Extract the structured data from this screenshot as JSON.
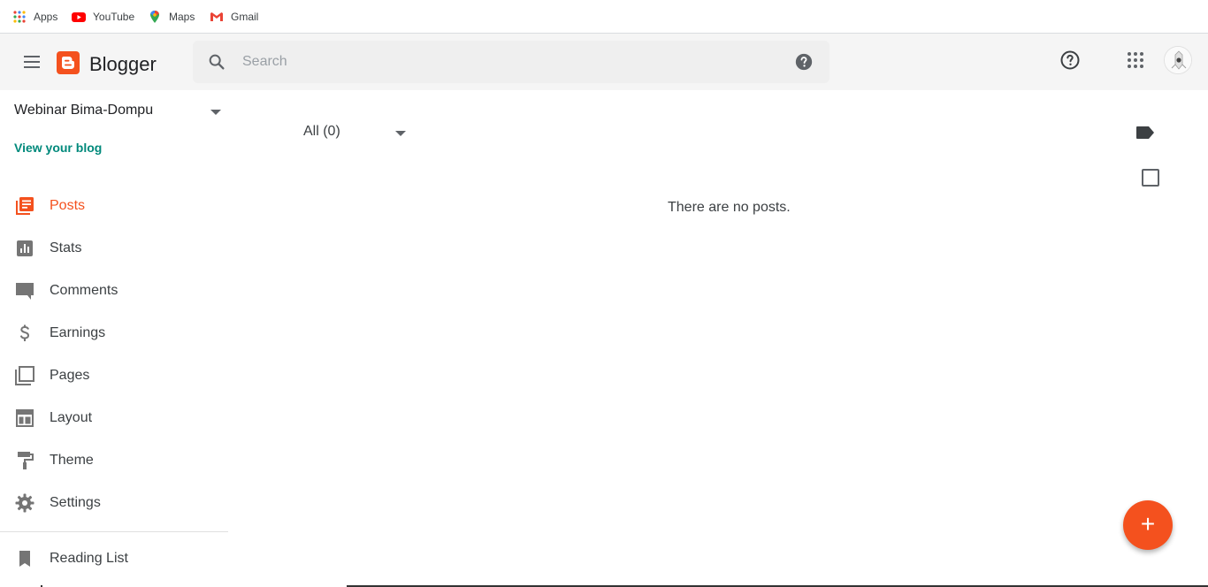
{
  "bookmarks": {
    "items": [
      {
        "label": "Apps",
        "icon": "apps-grid-icon"
      },
      {
        "label": "YouTube",
        "icon": "youtube-icon"
      },
      {
        "label": "Maps",
        "icon": "maps-pin-icon"
      },
      {
        "label": "Gmail",
        "icon": "gmail-icon"
      }
    ]
  },
  "header": {
    "brand": "Blogger",
    "search_placeholder": "Search"
  },
  "sidebar": {
    "blog_name": "Webinar Bima-Dompu",
    "view_blog": "View your blog",
    "items": [
      {
        "label": "Posts",
        "icon": "posts-icon",
        "active": true
      },
      {
        "label": "Stats",
        "icon": "stats-icon"
      },
      {
        "label": "Comments",
        "icon": "comment-icon"
      },
      {
        "label": "Earnings",
        "icon": "dollar-icon"
      },
      {
        "label": "Pages",
        "icon": "pages-icon"
      },
      {
        "label": "Layout",
        "icon": "layout-icon"
      },
      {
        "label": "Theme",
        "icon": "paint-roller-icon"
      },
      {
        "label": "Settings",
        "icon": "gear-icon"
      }
    ],
    "reading_list": "Reading List"
  },
  "main": {
    "filter_label": "All (0)",
    "empty_message": "There are no posts.",
    "fab_label": "+"
  },
  "colors": {
    "accent": "#f4511e",
    "link": "#00897b",
    "header_bg": "#f5f5f5"
  }
}
